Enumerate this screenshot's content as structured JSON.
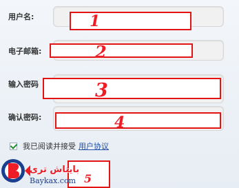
{
  "form": {
    "username_label": "用户名:",
    "email_label": "电子邮箱:",
    "password_label": "输入密码",
    "confirm_label": "确认密码:",
    "agree_text": "我已阅读并接受",
    "agree_link": "用户协议",
    "agree_checked": true
  },
  "annotations": [
    "1",
    "2",
    "3",
    "4",
    "5"
  ],
  "watermark": {
    "persian_text": "بایتاش تری",
    "url_text": "Baykax.com"
  },
  "colors": {
    "annotation_red": "#e31313",
    "link_blue": "#1f4fa8",
    "checkmark_green": "#1f8a2e"
  }
}
